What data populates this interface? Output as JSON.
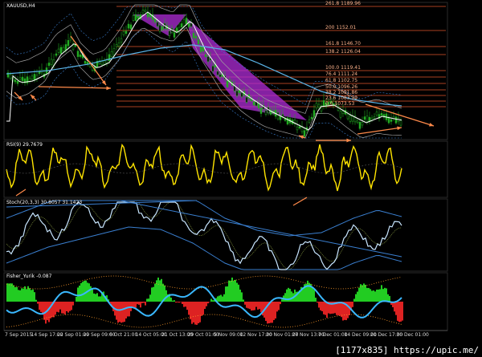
{
  "colors": {
    "background": "#000000",
    "frame": "#2a2a2a",
    "fib": "#e0542a",
    "candle": "#22aa22",
    "ma_fast": "#ffffff",
    "ma_slow": "#5ab4e8",
    "envelope": "#a0a0a0",
    "bands": "#3a7fd0",
    "arrow": "#ff8a4a",
    "pattern": "#b02cd8",
    "rsi": "#ffe400",
    "hist_pos": "#22cc22",
    "hist_neg": "#dd2222",
    "fisher_line": "#3ab8ff",
    "dots": "#ff9a2a"
  },
  "panels": {
    "main": {
      "symbol_label": "XAUUSD,H4"
    },
    "rsi": {
      "label": "RSI(9) 29.7679"
    },
    "stoch": {
      "label": "Stoch(20,3,3) 30.8057 31.1423"
    },
    "fisher": {
      "label": "Fisher_Yurik -0.087"
    }
  },
  "fib_levels": [
    "261.8 1189.96",
    "200 1152.01",
    "161.8 1146.70",
    "138.2 1126.04",
    "100.0 1119.41",
    "76.4 1111.24",
    "61.8 1102.75",
    "50.0 1096.26",
    "38.2 1091.86",
    "23.6 1083.29",
    "0.0 1073.53"
  ],
  "time_axis": [
    "7 Sep 2015",
    "14 Sep 17:00",
    "22 Sep 01:00",
    "29 Sep 09:00",
    "6 Oct 21:00",
    "14 Oct 05:00",
    "21 Oct 13:00",
    "29 Oct 01:00",
    "5 Nov 09:00",
    "12 Nov 17:00",
    "20 Nov 01:00",
    "27 Nov 13:00",
    "7 Dec 01:00",
    "14 Dec 09:00",
    "21 Dec 17:00",
    "30 Dec 01:00"
  ],
  "watermark": "[1177x835] https://upic.me/"
}
